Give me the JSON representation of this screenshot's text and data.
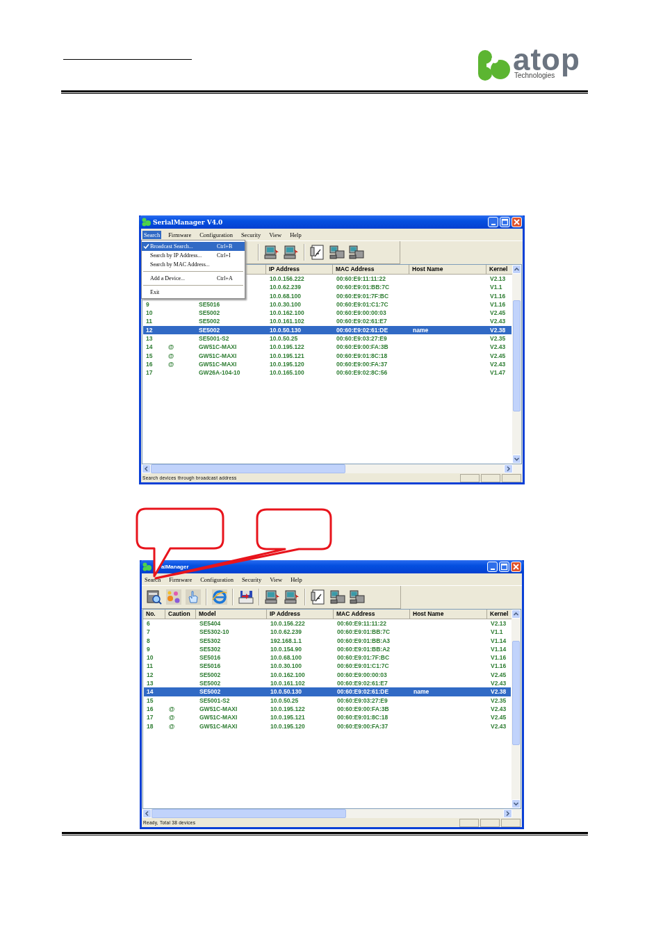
{
  "header": {
    "logo": "atop",
    "logo_sub": "Technologies"
  },
  "windows": [
    {
      "title": "SerialManager V4.0",
      "menus": [
        {
          "label": "Search",
          "selected": true
        },
        {
          "label": "Firmware",
          "selected": false
        },
        {
          "label": "Configuration",
          "selected": false
        },
        {
          "label": "Security",
          "selected": false
        },
        {
          "label": "View",
          "selected": false
        },
        {
          "label": "Help",
          "selected": false
        }
      ],
      "open_menu": {
        "items": [
          {
            "kind": "item",
            "label": "Broadcast Search...",
            "shortcut": "Ctrl+B",
            "checked": true,
            "selected": true
          },
          {
            "kind": "item",
            "label": "Search by IP Address...",
            "shortcut": "Ctrl+I",
            "checked": false,
            "selected": false
          },
          {
            "kind": "item",
            "label": "Search by MAC Address...",
            "checked": false,
            "selected": false
          },
          {
            "kind": "separator"
          },
          {
            "kind": "item",
            "label": "Add a Device...",
            "shortcut": "Ctrl+A",
            "checked": false,
            "selected": false
          },
          {
            "kind": "separator"
          },
          {
            "kind": "item",
            "label": "Exit",
            "checked": false,
            "selected": false
          }
        ]
      },
      "columns": {
        "ip": "IP Address",
        "mac": "MAC Address",
        "host": "Host Name",
        "kernel": "Kernel"
      },
      "rows": [
        {
          "ip": "10.0.156.222",
          "mac": "00:60:E9:11:11:22",
          "kernel": "V2.13",
          "selected": false
        },
        {
          "ip": "10.0.62.239",
          "mac": "00:60:E9:01:BB:7C",
          "kernel": "V1.1",
          "selected": false
        },
        {
          "ip": "10.0.68.100",
          "mac": "00:60:E9:01:7F:BC",
          "kernel": "V1.16",
          "selected": false
        },
        {
          "no": "9",
          "model": "SE5016",
          "ip": "10.0.30.100",
          "mac": "00:60:E9:01:C1:7C",
          "kernel": "V1.16",
          "selected": false
        },
        {
          "no": "10",
          "model": "SE5002",
          "ip": "10.0.162.100",
          "mac": "00:60:E9:00:00:03",
          "kernel": "V2.45",
          "selected": false
        },
        {
          "no": "11",
          "model": "SE5002",
          "ip": "10.0.161.102",
          "mac": "00:60:E9:02:61:E7",
          "kernel": "V2.43",
          "selected": false
        },
        {
          "no": "12",
          "model": "SE5002",
          "ip": "10.0.50.130",
          "mac": "00:60:E9:02:61:DE",
          "host": "name",
          "kernel": "V2.38",
          "selected": true
        },
        {
          "no": "13",
          "model": "SE5001-S2",
          "ip": "10.0.50.25",
          "mac": "00:60:E9:03:27:E9",
          "kernel": "V2.35",
          "selected": false
        },
        {
          "no": "14",
          "caution": "@",
          "model": "GW51C-MAXI",
          "ip": "10.0.195.122",
          "mac": "00:60:E9:00:FA:3B",
          "kernel": "V2.43",
          "selected": false
        },
        {
          "no": "15",
          "caution": "@",
          "model": "GW51C-MAXI",
          "ip": "10.0.195.121",
          "mac": "00:60:E9:01:8C:18",
          "kernel": "V2.45",
          "selected": false
        },
        {
          "no": "16",
          "caution": "@",
          "model": "GW51C-MAXI",
          "ip": "10.0.195.120",
          "mac": "00:60:E9:00:FA:37",
          "kernel": "V2.43",
          "selected": false
        },
        {
          "no": "17",
          "model": "GW26A-104-10",
          "ip": "10.0.165.100",
          "mac": "00:60:E9:02:8C:56",
          "kernel": "V1.47",
          "selected": false
        }
      ],
      "status": "Search devices through broadcast address"
    },
    {
      "title": "alManager",
      "menus": [
        {
          "label": "Search",
          "selected": false
        },
        {
          "label": "Firmware",
          "selected": false
        },
        {
          "label": "Configuration",
          "selected": false
        },
        {
          "label": "Security",
          "selected": false
        },
        {
          "label": "View",
          "selected": false
        },
        {
          "label": "Help",
          "selected": false
        }
      ],
      "columns": {
        "no": "No.",
        "caution": "Caution",
        "model": "Model",
        "ip": "IP Address",
        "mac": "MAC Address",
        "host": "Host Name",
        "kernel": "Kernel"
      },
      "rows": [
        {
          "no": "6",
          "model": "SE5404",
          "ip": "10.0.156.222",
          "mac": "00:60:E9:11:11:22",
          "kernel": "V2.13",
          "selected": false
        },
        {
          "no": "7",
          "model": "SE5302-10",
          "ip": "10.0.62.239",
          "mac": "00:60:E9:01:BB:7C",
          "kernel": "V1.1",
          "selected": false
        },
        {
          "no": "8",
          "model": "SE5302",
          "ip": "192.168.1.1",
          "mac": "00:60:E9:01:BB:A3",
          "kernel": "V1.14",
          "selected": false
        },
        {
          "no": "9",
          "model": "SE5302",
          "ip": "10.0.154.90",
          "mac": "00:60:E9:01:BB:A2",
          "kernel": "V1.14",
          "selected": false
        },
        {
          "no": "10",
          "model": "SE5016",
          "ip": "10.0.68.100",
          "mac": "00:60:E9:01:7F:BC",
          "kernel": "V1.16",
          "selected": false
        },
        {
          "no": "11",
          "model": "SE5016",
          "ip": "10.0.30.100",
          "mac": "00:60:E9:01:C1:7C",
          "kernel": "V1.16",
          "selected": false
        },
        {
          "no": "12",
          "model": "SE5002",
          "ip": "10.0.162.100",
          "mac": "00:60:E9:00:00:03",
          "kernel": "V2.45",
          "selected": false
        },
        {
          "no": "13",
          "model": "SE5002",
          "ip": "10.0.161.102",
          "mac": "00:60:E9:02:61:E7",
          "kernel": "V2.43",
          "selected": false
        },
        {
          "no": "14",
          "model": "SE5002",
          "ip": "10.0.50.130",
          "mac": "00:60:E9:02:61:DE",
          "host": "name",
          "kernel": "V2.38",
          "selected": true
        },
        {
          "no": "15",
          "model": "SE5001-S2",
          "ip": "10.0.50.25",
          "mac": "00:60:E9:03:27:E9",
          "kernel": "V2.35",
          "selected": false
        },
        {
          "no": "16",
          "caution": "@",
          "model": "GW51C-MAXI",
          "ip": "10.0.195.122",
          "mac": "00:60:E9:00:FA:3B",
          "kernel": "V2.43",
          "selected": false
        },
        {
          "no": "17",
          "caution": "@",
          "model": "GW51C-MAXI",
          "ip": "10.0.195.121",
          "mac": "00:60:E9:01:8C:18",
          "kernel": "V2.45",
          "selected": false
        },
        {
          "no": "18",
          "caution": "@",
          "model": "GW51C-MAXI",
          "ip": "10.0.195.120",
          "mac": "00:60:E9:00:FA:37",
          "kernel": "V2.43",
          "selected": false
        }
      ],
      "status": "Ready, Total 38 devices"
    }
  ]
}
